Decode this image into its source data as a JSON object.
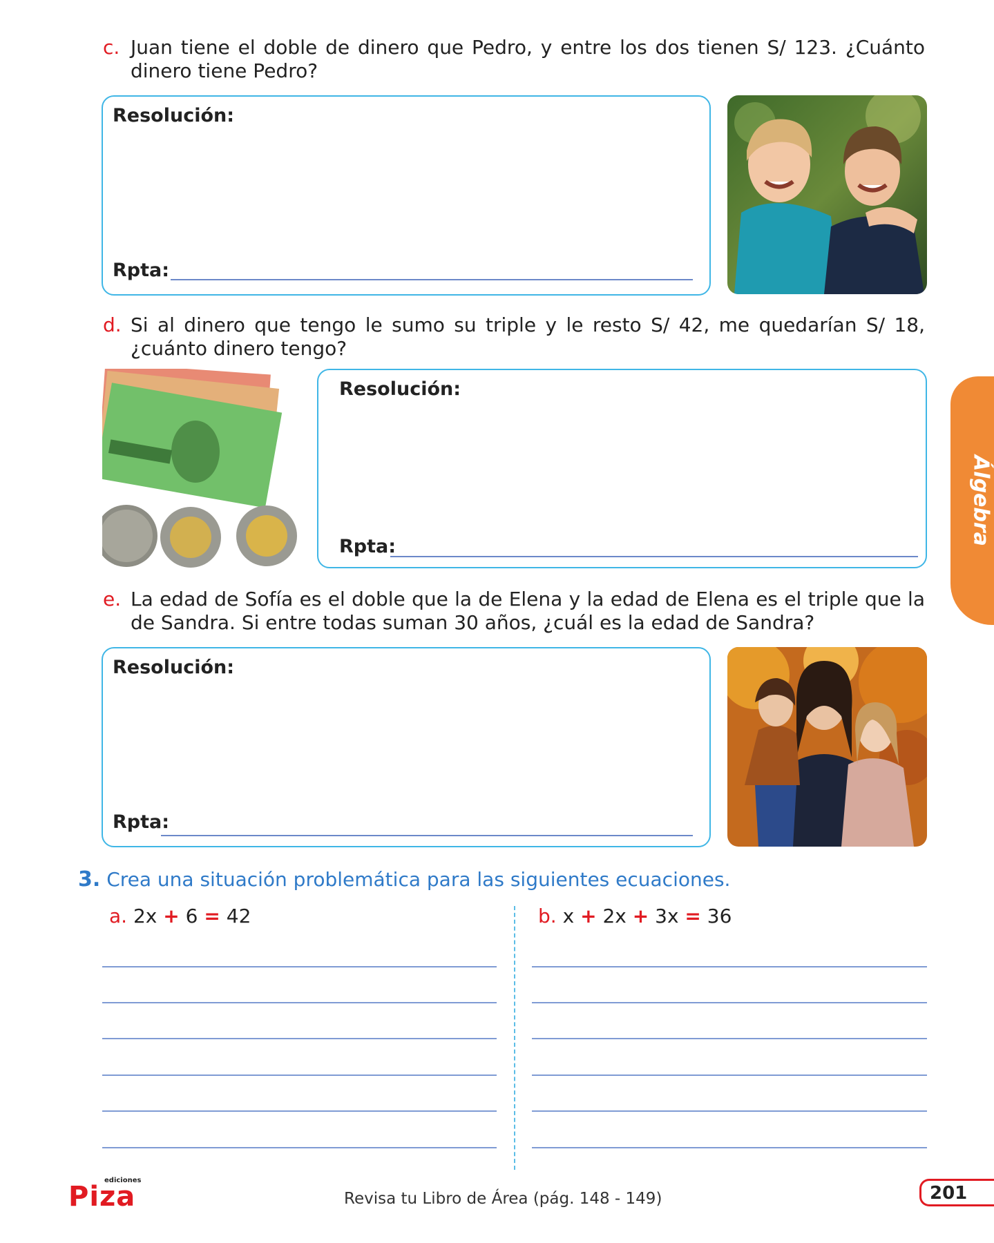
{
  "problems": {
    "c": {
      "letter": "c.",
      "text": "Juan tiene el doble de dinero que Pedro, y entre los dos tienen S/ 123. ¿Cuánto dinero tiene Pedro?"
    },
    "d": {
      "letter": "d.",
      "text": "Si al dinero que tengo le sumo su triple y le resto S/ 42, me quedarían S/ 18, ¿cuánto dinero tengo?"
    },
    "e": {
      "letter": "e.",
      "text": "La edad de Sofía es el doble que la de Elena y la edad de Elena es el triple que la de Sandra. Si entre todas suman 30 años, ¿cuál es la edad de Sandra?"
    }
  },
  "resolution_label": "Resolución:",
  "answer_label": "Rpta:",
  "side_tab": {
    "label": "Álgebra",
    "color": "#f08a35"
  },
  "section3": {
    "number": "3.",
    "title": "Crea una situación problemática para las siguientes ecuaciones.",
    "a": {
      "letter": "a.",
      "t1": "2x",
      "op1": "+",
      "t2": "6",
      "eq": "=",
      "t3": "42"
    },
    "b": {
      "letter": "b.",
      "t1": "x",
      "op1": "+",
      "t2": "2x",
      "op2": "+",
      "t3": "3x",
      "eq": "=",
      "t4": "36"
    }
  },
  "footer": {
    "brand_small": "ediciones",
    "brand": "Piza",
    "note": "Revisa tu Libro de Área (pág. 148 - 149)",
    "page_number": "201"
  },
  "colors": {
    "accent_red": "#e11b22",
    "box_border": "#3fb6e6",
    "title_blue": "#2f7ac8",
    "tab_orange": "#f08a35"
  },
  "images": [
    "two-boys-photo",
    "peruvian-money-photo",
    "mother-daughters-photo"
  ]
}
